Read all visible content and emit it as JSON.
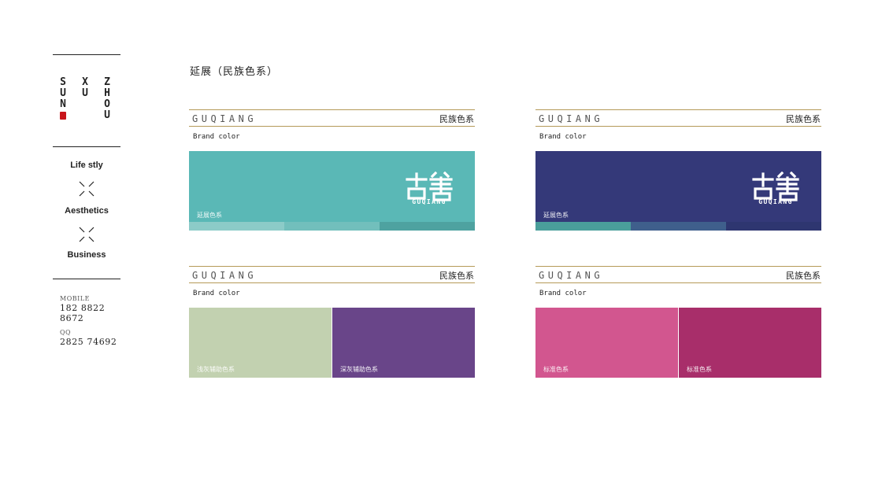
{
  "sidebar": {
    "logo": {
      "col1": [
        "S",
        "U",
        "N"
      ],
      "col2": [
        "X",
        "U"
      ],
      "col3": [
        "Z",
        "H",
        "O",
        "U"
      ]
    },
    "nav": [
      "Life stly",
      "Aesthetics",
      "Business"
    ],
    "contact": {
      "mobile_label": "MOBILE",
      "mobile_value": "182 8822 8672",
      "qq_label": "QQ",
      "qq_value": "2825 74692"
    }
  },
  "page_title": "延展（民族色系）",
  "cards": [
    {
      "brand": "GUQIANG",
      "cn_title": "民族色系",
      "sub_title": "Brand color",
      "swatch_label": "延展色系",
      "emblem_text": "GUQIANG",
      "color": "#5ab8b6",
      "strip_colors": [
        "#8ccbc8",
        "#72bfbc",
        "#4ea2a0"
      ]
    },
    {
      "brand": "GUQIANG",
      "cn_title": "民族色系",
      "sub_title": "Brand color",
      "swatch_label": "延展色系",
      "emblem_text": "GUQIANG",
      "color": "#343979",
      "strip_colors": [
        "#4a9e9b",
        "#3f5f8c",
        "#2e3670"
      ]
    },
    {
      "brand": "GUQIANG",
      "cn_title": "民族色系",
      "sub_title": "Brand color",
      "swatches": [
        {
          "label": "浅灰辅助色系",
          "color": "#c2d1b0"
        },
        {
          "label": "深灰辅助色系",
          "color": "#694589"
        }
      ]
    },
    {
      "brand": "GUQIANG",
      "cn_title": "民族色系",
      "sub_title": "Brand color",
      "swatches": [
        {
          "label": "标准色系",
          "color": "#d2568f"
        },
        {
          "label": "标准色系",
          "color": "#a82e6a"
        }
      ]
    }
  ]
}
